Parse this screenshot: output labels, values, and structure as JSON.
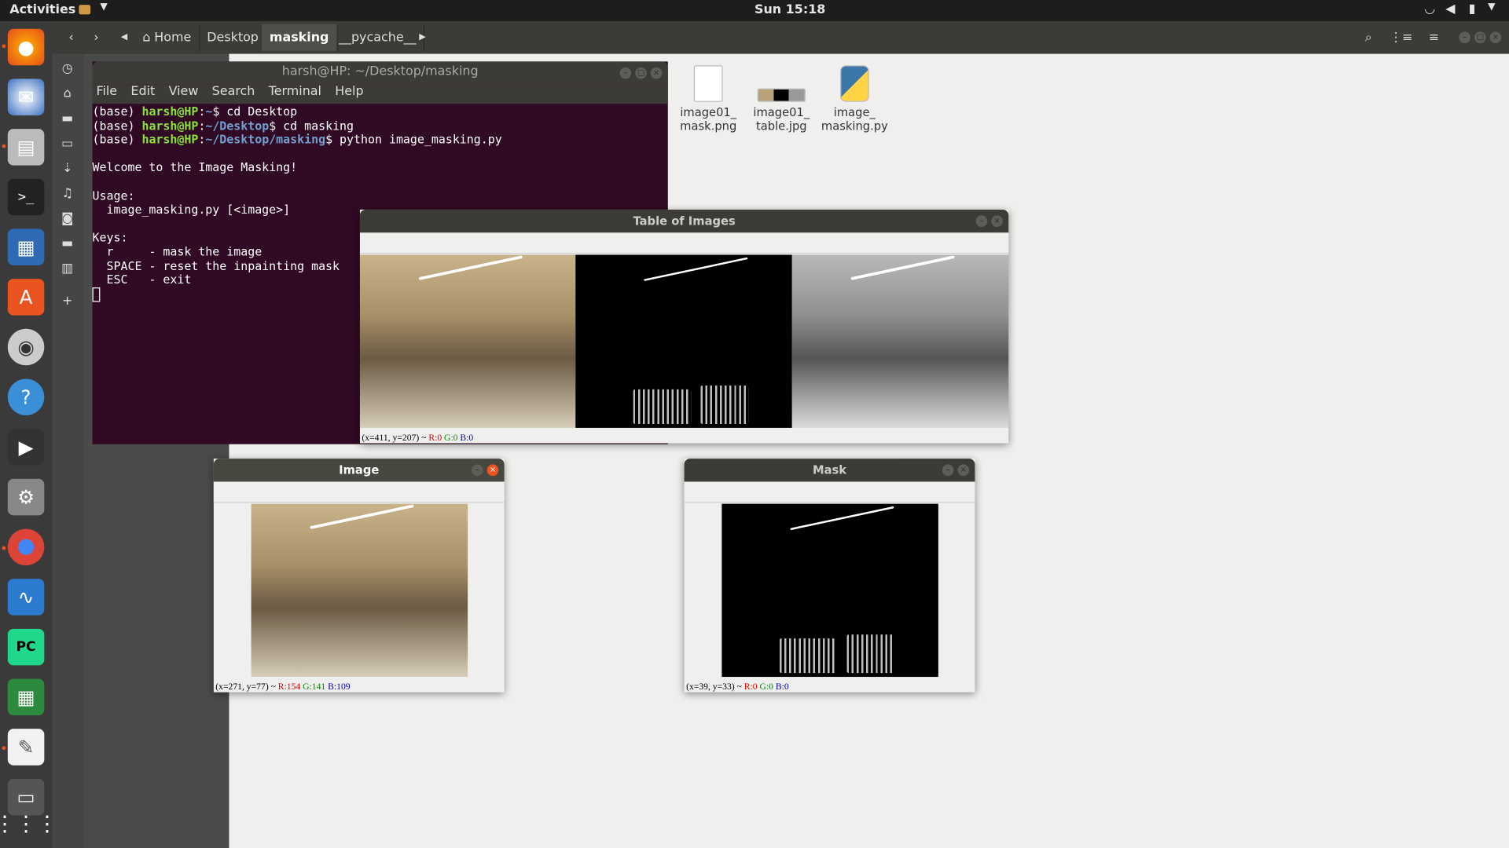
{
  "topbar": {
    "activities": "Activities",
    "clock": "Sun 15:18"
  },
  "dock": {
    "items": [
      "firefox-icon",
      "thunderbird-icon",
      "files-icon",
      "terminal-icon",
      "writer-icon",
      "software-center-icon",
      "rhythmbox-icon",
      "help-icon",
      "video-editor-icon",
      "settings-icon",
      "chrome-icon",
      "system-monitor-icon",
      "pycharm-icon",
      "calc-icon",
      "text-editor-icon",
      "trash-icon",
      "apps-grid-icon"
    ]
  },
  "filemanager": {
    "crumbs": [
      "Home",
      "Desktop",
      "masking",
      "__pycache__"
    ],
    "files": [
      {
        "name": "image01_\nmask.png"
      },
      {
        "name": "image01_\ntable.jpg"
      },
      {
        "name": "image_\nmasking.py"
      }
    ]
  },
  "terminal": {
    "title": "harsh@HP: ~/Desktop/masking",
    "menu": [
      "File",
      "Edit",
      "View",
      "Search",
      "Terminal",
      "Help"
    ],
    "lines": [
      {
        "env": "(base) ",
        "user": "harsh@HP",
        "sep": ":",
        "path": "~",
        "cmd": "$ cd Desktop"
      },
      {
        "env": "(base) ",
        "user": "harsh@HP",
        "sep": ":",
        "path": "~/Desktop",
        "cmd": "$ cd masking"
      },
      {
        "env": "(base) ",
        "user": "harsh@HP",
        "sep": ":",
        "path": "~/Desktop/masking",
        "cmd": "$ python image_masking.py"
      }
    ],
    "output": "\nWelcome to the Image Masking!\n\nUsage:\n  image_masking.py [<image>]\n\nKeys:\n  r     - mask the image\n  SPACE - reset the inpainting mask\n  ESC   - exit\n"
  },
  "windows": {
    "table": {
      "title": "Table of Images",
      "status_prefix": "(x=411, y=207) ~ ",
      "r": "R:0",
      "g": "G:0",
      "b": "B:0"
    },
    "image": {
      "title": "Image",
      "status_prefix": "(x=271, y=77) ~ ",
      "r": "R:154",
      "g": "G:141",
      "b": "B:109"
    },
    "mask": {
      "title": "Mask",
      "status_prefix": "(x=39, y=33) ~ ",
      "r": "R:0",
      "g": "G:0",
      "b": "B:0"
    }
  }
}
